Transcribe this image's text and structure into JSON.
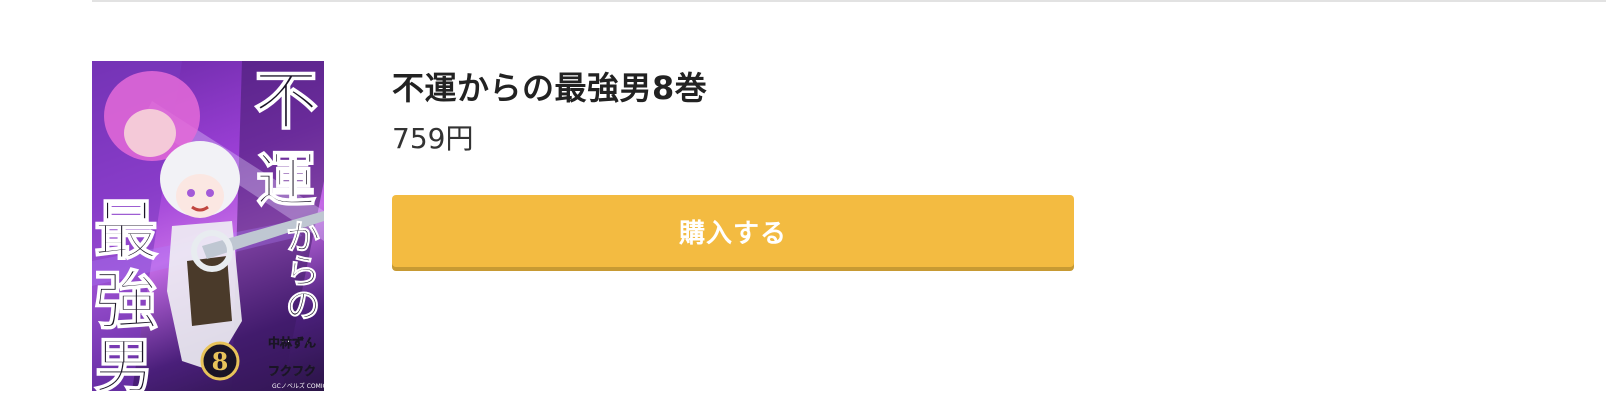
{
  "product": {
    "title": "不運からの最強男8巻",
    "price": "759円",
    "buy_label": "購入する",
    "cover": {
      "title_text": "不運からの最強男",
      "volume": "8",
      "author_1": "中林ずん",
      "author_2": "フクフク",
      "publisher_mark": "GCノベルズ COMICS"
    }
  },
  "colors": {
    "accent": "#f3bb41",
    "accent_shadow": "#c79a33",
    "divider": "#e2e2e2",
    "title_text": "#222222",
    "price_text": "#333333"
  }
}
